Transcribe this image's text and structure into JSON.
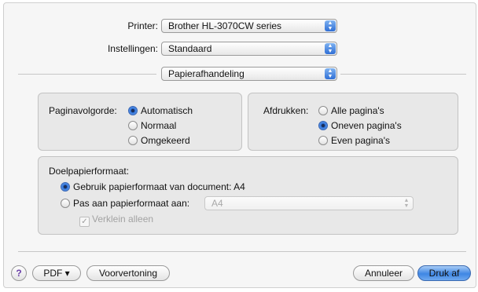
{
  "printer": {
    "label": "Printer:",
    "value": "Brother HL-3070CW series"
  },
  "settings": {
    "label": "Instellingen:",
    "value": "Standaard"
  },
  "panel_select": {
    "value": "Papierafhandeling"
  },
  "page_order": {
    "label": "Paginavolgorde:",
    "options": [
      "Automatisch",
      "Normaal",
      "Omgekeerd"
    ],
    "selected": "Automatisch"
  },
  "print_pages": {
    "label": "Afdrukken:",
    "options": [
      "Alle pagina's",
      "Oneven pagina's",
      "Even pagina's"
    ],
    "selected": "Oneven pagina's"
  },
  "destination_paper": {
    "label": "Doelpapierformaat:",
    "use_document": "Gebruik papierformaat van document: A4",
    "scale_to": "Pas aan papierformaat aan:",
    "scale_value": "A4",
    "scale_down_only": "Verklein alleen"
  },
  "footer": {
    "help": "?",
    "pdf": "PDF ▾",
    "preview": "Voorvertoning",
    "cancel": "Annuleer",
    "print": "Druk af"
  },
  "colors": {
    "accent": "#2f6fd6"
  }
}
